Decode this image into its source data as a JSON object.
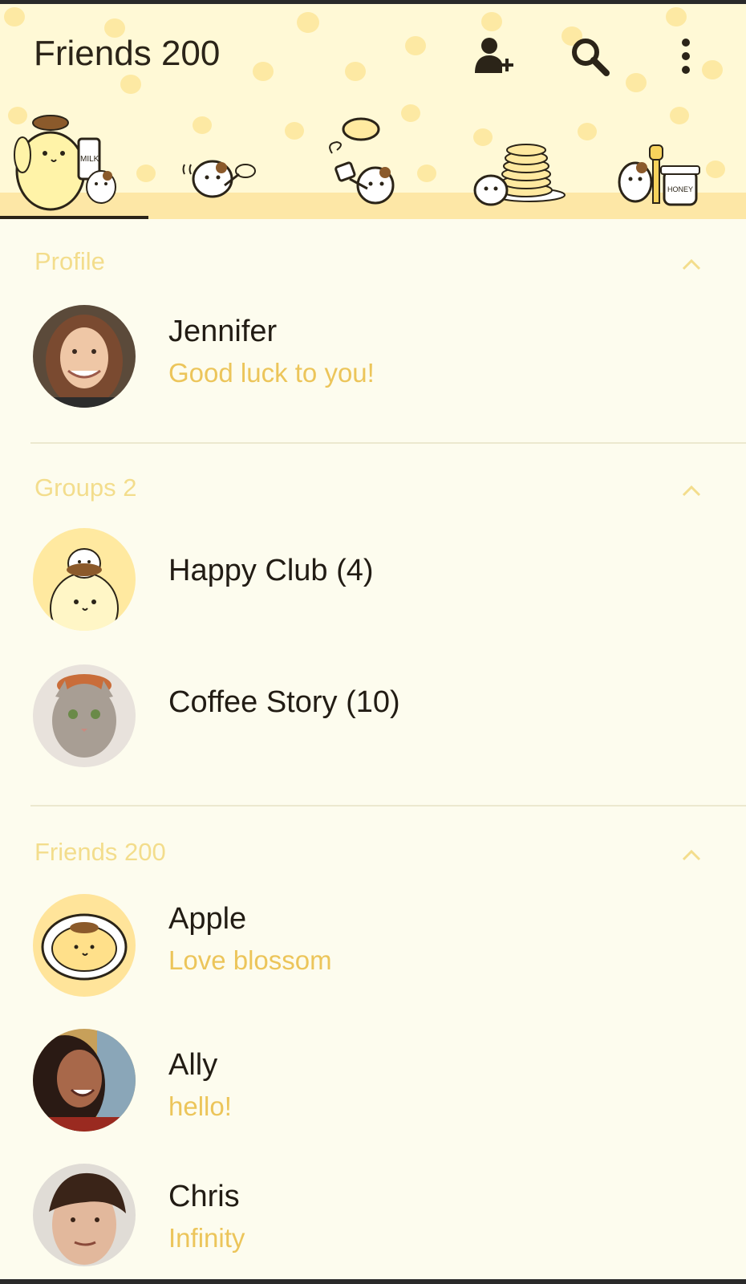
{
  "header": {
    "title": "Friends 200",
    "add_friend_icon": "person-add-icon",
    "search_icon": "search-icon",
    "more_icon": "more-vert-icon"
  },
  "tabs": [
    {
      "name": "friends",
      "icon": "pompompurin-milk-icon",
      "selected": true
    },
    {
      "name": "chats",
      "icon": "cat-whisk-icon",
      "selected": false
    },
    {
      "name": "timeline",
      "icon": "cat-pancake-flip-icon",
      "selected": false
    },
    {
      "name": "shop",
      "icon": "pancake-stack-icon",
      "selected": false
    },
    {
      "name": "more",
      "icon": "cat-honey-jar-icon",
      "selected": false
    }
  ],
  "sections": {
    "profile": {
      "title": "Profile",
      "items": [
        {
          "name": "Jennifer",
          "status": "Good luck to you!"
        }
      ]
    },
    "groups": {
      "title": "Groups 2",
      "items": [
        {
          "name": "Happy Club (4)"
        },
        {
          "name": "Coffee Story (10)"
        }
      ]
    },
    "friends": {
      "title": "Friends 200",
      "items": [
        {
          "name": "Apple",
          "status": "Love blossom"
        },
        {
          "name": "Ally",
          "status": "hello!"
        },
        {
          "name": "Chris",
          "status": "Infinity"
        }
      ]
    }
  },
  "decor": {
    "milk_label": "MILK",
    "honey_label": "HONEY"
  },
  "colors": {
    "background": "#fdfcee",
    "header": "#fff9d6",
    "accent": "#ecc55a",
    "section_title": "#f3dd8c",
    "text": "#221c14"
  }
}
